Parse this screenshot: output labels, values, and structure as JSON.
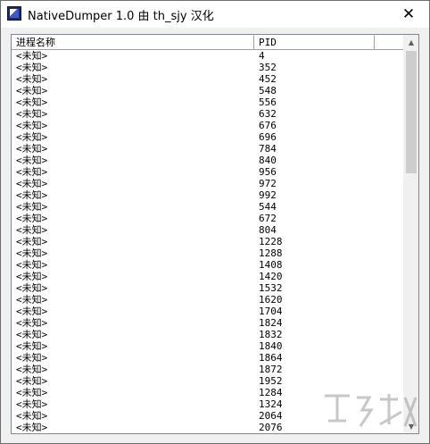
{
  "window": {
    "title": "NativeDumper 1.0 由 th_sjy 汉化",
    "close_glyph": "✕"
  },
  "list": {
    "columns": [
      "进程名称",
      "PID"
    ],
    "rows": [
      {
        "name": "<未知>",
        "pid": "4"
      },
      {
        "name": "<未知>",
        "pid": "352"
      },
      {
        "name": "<未知>",
        "pid": "452"
      },
      {
        "name": "<未知>",
        "pid": "548"
      },
      {
        "name": "<未知>",
        "pid": "556"
      },
      {
        "name": "<未知>",
        "pid": "632"
      },
      {
        "name": "<未知>",
        "pid": "676"
      },
      {
        "name": "<未知>",
        "pid": "696"
      },
      {
        "name": "<未知>",
        "pid": "784"
      },
      {
        "name": "<未知>",
        "pid": "840"
      },
      {
        "name": "<未知>",
        "pid": "956"
      },
      {
        "name": "<未知>",
        "pid": "972"
      },
      {
        "name": "<未知>",
        "pid": "992"
      },
      {
        "name": "<未知>",
        "pid": "544"
      },
      {
        "name": "<未知>",
        "pid": "672"
      },
      {
        "name": "<未知>",
        "pid": "804"
      },
      {
        "name": "<未知>",
        "pid": "1228"
      },
      {
        "name": "<未知>",
        "pid": "1288"
      },
      {
        "name": "<未知>",
        "pid": "1408"
      },
      {
        "name": "<未知>",
        "pid": "1420"
      },
      {
        "name": "<未知>",
        "pid": "1532"
      },
      {
        "name": "<未知>",
        "pid": "1620"
      },
      {
        "name": "<未知>",
        "pid": "1704"
      },
      {
        "name": "<未知>",
        "pid": "1824"
      },
      {
        "name": "<未知>",
        "pid": "1832"
      },
      {
        "name": "<未知>",
        "pid": "1840"
      },
      {
        "name": "<未知>",
        "pid": "1864"
      },
      {
        "name": "<未知>",
        "pid": "1872"
      },
      {
        "name": "<未知>",
        "pid": "1952"
      },
      {
        "name": "<未知>",
        "pid": "1284"
      },
      {
        "name": "<未知>",
        "pid": "1324"
      },
      {
        "name": "<未知>",
        "pid": "2064"
      },
      {
        "name": "<未知>",
        "pid": "2076"
      }
    ]
  },
  "scrollbar": {
    "up_glyph": "▲",
    "down_glyph": "▼"
  },
  "icons": {
    "app": "app-icon",
    "close": "close-icon"
  }
}
